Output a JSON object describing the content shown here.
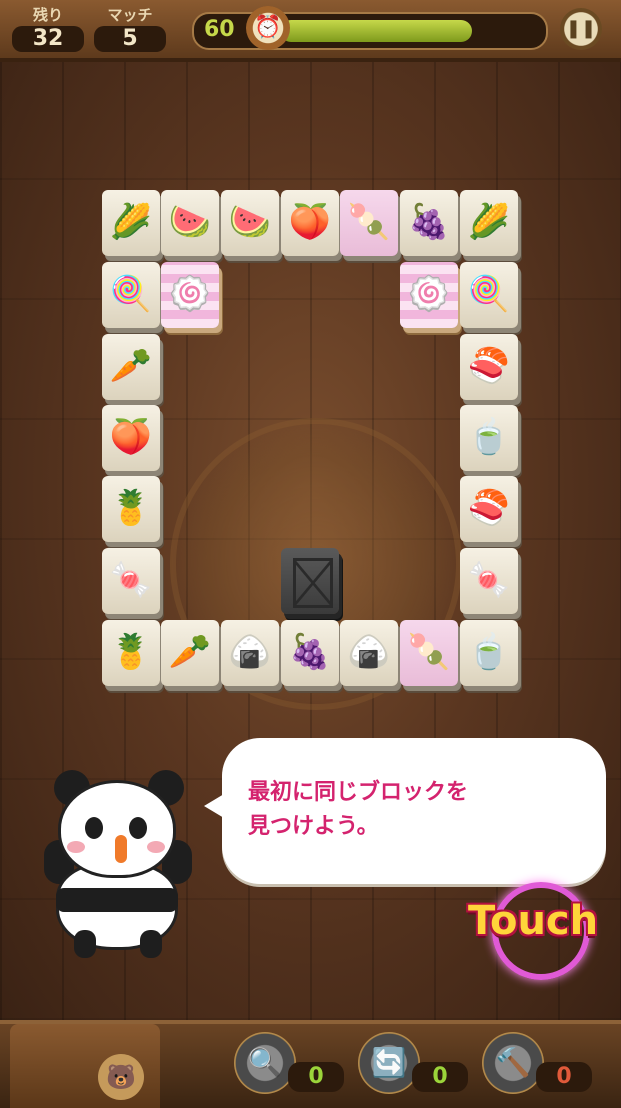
{
  "header": {
    "remaining_label": "残り",
    "remaining_value": "32",
    "match_label": "マッチ",
    "match_value": "5",
    "timer_value": "60",
    "timer_progress": 0.75
  },
  "board": {
    "tiles": [
      {
        "icon": "🌽",
        "style": "normal"
      },
      {
        "icon": "🍉",
        "style": "normal"
      },
      {
        "icon": "🍉",
        "style": "normal"
      },
      {
        "icon": "🍑",
        "style": "normal"
      },
      {
        "icon": "🍡",
        "style": "pink"
      },
      {
        "icon": "🍇",
        "style": "normal"
      },
      {
        "icon": "🌽",
        "style": "normal"
      },
      {
        "icon": "🍭",
        "style": "normal"
      },
      {
        "icon": "🍥",
        "style": "selected"
      },
      {
        "icon": "🍥",
        "style": "selected"
      },
      {
        "icon": "🍭",
        "style": "normal"
      },
      {
        "icon": "🥕",
        "style": "normal"
      },
      {
        "icon": "🍣",
        "style": "normal"
      },
      {
        "icon": "🍑",
        "style": "normal"
      },
      {
        "icon": "🍵",
        "style": "normal"
      },
      {
        "icon": "🍍",
        "style": "normal"
      },
      {
        "icon": "🍣",
        "style": "normal"
      },
      {
        "icon": "🍬",
        "style": "normal"
      },
      {
        "icon": "🍬",
        "style": "normal"
      },
      {
        "icon": "",
        "style": "blocker"
      },
      {
        "icon": "🍍",
        "style": "normal"
      },
      {
        "icon": "🥕",
        "style": "normal"
      },
      {
        "icon": "🍙",
        "style": "normal"
      },
      {
        "icon": "🍇",
        "style": "normal"
      },
      {
        "icon": "🍙",
        "style": "normal"
      },
      {
        "icon": "🍡",
        "style": "pink"
      },
      {
        "icon": "🍵",
        "style": "normal"
      }
    ]
  },
  "tutorial": {
    "line1": "最初に同じブロックを",
    "line2": "見つけよう。",
    "touch_label": "Touch"
  },
  "footer": {
    "items": [
      {
        "icon": "search-icon",
        "glyph": "🔍",
        "count": "0",
        "count_color": "#9bd43a"
      },
      {
        "icon": "shuffle-icon",
        "glyph": "🔄",
        "count": "0",
        "count_color": "#9bd43a"
      },
      {
        "icon": "hammer-icon",
        "glyph": "🔨",
        "count": "0",
        "count_color": "#e05a3a"
      }
    ],
    "shop_glyph": "🐻"
  }
}
